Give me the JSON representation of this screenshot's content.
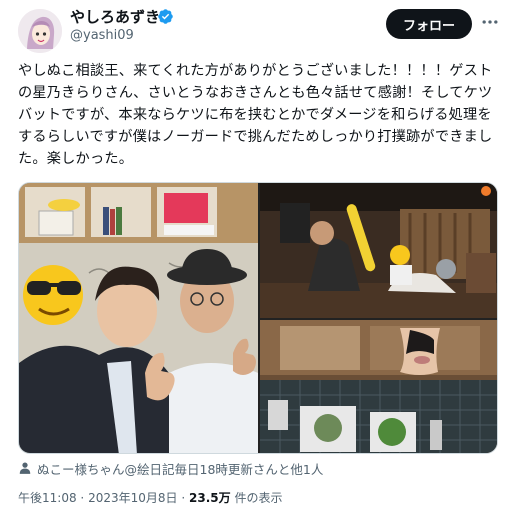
{
  "author": {
    "display_name": "やしろあずき",
    "handle": "@yashi09",
    "verified": true,
    "avatar": "avatar-illustration"
  },
  "actions": {
    "follow_label": "フォロー",
    "more_icon": "more-dots-icon"
  },
  "tweet": {
    "text": "やしぬこ相談王、来てくれた方がありがとうございました！！！！ゲストの星乃きらりさん、さいとうなおきさんとも色々話せて感謝！そしてケツバットですが、本来ならケツに布を挟むとかでダメージを和らげる処理をするらしいですが僕はノーガードで挑んだためしっかり打撲跡ができました。楽しかった。"
  },
  "media": {
    "photos": [
      "photo-two-men-thumbs-up",
      "photo-bat-swing-stage",
      "photo-bruise"
    ],
    "emoji_overlay": "sunglasses-emoji"
  },
  "tagged": {
    "icon": "person-icon",
    "text": "ぬこー様ちゃん@絵日記毎日18時更新さんと他1人"
  },
  "meta": {
    "time": "午後11:08",
    "separator": "·",
    "date": "2023年10月8日",
    "views_count": "23.5万",
    "views_label": "件の表示"
  },
  "colors": {
    "text": "#0f1419",
    "secondary": "#536471",
    "verified": "#1d9bf0",
    "button": "#0f1419"
  }
}
